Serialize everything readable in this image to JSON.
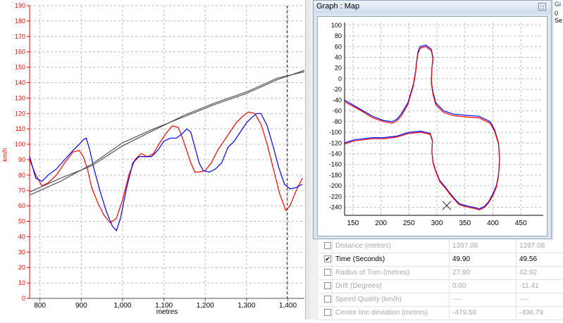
{
  "speed_chart": {
    "ylabel": "km/h",
    "xlabel": "metres",
    "y_ticks": [
      "0",
      "10",
      "20",
      "30",
      "40",
      "50",
      "60",
      "70",
      "80",
      "90",
      "100",
      "110",
      "120",
      "130",
      "140",
      "150",
      "160",
      "170",
      "180",
      "190"
    ],
    "x_ticks": [
      "800",
      "900",
      "1,000",
      "1,100",
      "1,200",
      "1,300",
      "1,400"
    ]
  },
  "map_window": {
    "title": "Graph : Map",
    "restore_label": "□",
    "y_ticks": [
      "100",
      "80",
      "60",
      "40",
      "20",
      "0",
      "-20",
      "-40",
      "-60",
      "-80",
      "-100",
      "-120",
      "-140",
      "-160",
      "-180",
      "-200",
      "-220",
      "-240"
    ],
    "x_ticks": [
      "150",
      "200",
      "250",
      "300",
      "350",
      "400",
      "450"
    ]
  },
  "side_strip": {
    "line1": "Gi",
    "line2": "0 Se"
  },
  "data_table": {
    "rows": [
      {
        "checked": false,
        "label": "Distance (metres)",
        "v1": "1397.08",
        "v2": "1397.08",
        "active": false
      },
      {
        "checked": true,
        "label": "Time (Seconds)",
        "v1": "49.90",
        "v2": "49.56",
        "active": true
      },
      {
        "checked": false,
        "label": "Radius of Turn (metres)",
        "v1": "27.90",
        "v2": "42.92",
        "active": false
      },
      {
        "checked": false,
        "label": "Drift (Degrees)",
        "v1": "0.00",
        "v2": "-11.41",
        "active": false
      },
      {
        "checked": false,
        "label": "Speed Quality (km/h)",
        "v1": "----",
        "v2": "----",
        "active": false
      },
      {
        "checked": false,
        "label": "Centre line deviation (metres)",
        "v1": "-479.58",
        "v2": "-496.79",
        "active": false
      }
    ]
  },
  "chart_data": [
    {
      "type": "line",
      "title": "",
      "xlabel": "metres",
      "ylabel": "km/h",
      "xlim": [
        775,
        1440
      ],
      "ylim": [
        0,
        190
      ],
      "grid": true,
      "cursor_x": 1398,
      "series": [
        {
          "color": "#ff0000",
          "x": [
            775,
            790,
            805,
            820,
            840,
            860,
            880,
            895,
            905,
            915,
            925,
            940,
            955,
            970,
            985,
            1000,
            1015,
            1030,
            1045,
            1060,
            1075,
            1090,
            1105,
            1120,
            1135,
            1145,
            1155,
            1165,
            1175,
            1185,
            1200,
            1215,
            1230,
            1245,
            1260,
            1275,
            1290,
            1305,
            1320,
            1335,
            1350,
            1365,
            1380,
            1395,
            1405,
            1420,
            1435
          ],
          "y": [
            90,
            80,
            73,
            75,
            80,
            88,
            95,
            96,
            92,
            84,
            72,
            62,
            54,
            49,
            52,
            64,
            80,
            90,
            94,
            92,
            94,
            101,
            107,
            112,
            111,
            104,
            96,
            88,
            82,
            82,
            83,
            88,
            96,
            102,
            108,
            114,
            118,
            121,
            120,
            113,
            100,
            84,
            68,
            57,
            60,
            70,
            78
          ]
        },
        {
          "color": "#0000ff",
          "x": [
            775,
            790,
            805,
            820,
            840,
            860,
            880,
            895,
            905,
            912,
            920,
            930,
            945,
            960,
            975,
            985,
            995,
            1010,
            1025,
            1040,
            1055,
            1070,
            1085,
            1100,
            1115,
            1130,
            1145,
            1155,
            1165,
            1175,
            1185,
            1195,
            1210,
            1225,
            1240,
            1255,
            1270,
            1285,
            1300,
            1315,
            1325,
            1335,
            1350,
            1365,
            1378,
            1392,
            1405,
            1420,
            1435
          ],
          "y": [
            92,
            78,
            76,
            80,
            84,
            90,
            96,
            100,
            103,
            104,
            97,
            85,
            70,
            57,
            47,
            44,
            52,
            72,
            88,
            92,
            92,
            92,
            96,
            102,
            104,
            104,
            107,
            110,
            108,
            98,
            88,
            83,
            82,
            84,
            88,
            98,
            102,
            108,
            114,
            118,
            120,
            120,
            112,
            98,
            85,
            74,
            71,
            72,
            74
          ]
        },
        {
          "color": "#555555",
          "x": [
            775,
            850,
            925,
            1000,
            1075,
            1150,
            1225,
            1300,
            1375,
            1440
          ],
          "y": [
            67,
            76,
            87,
            101,
            110,
            118,
            126,
            133,
            142,
            148
          ]
        },
        {
          "color": "#555555",
          "x": [
            775,
            850,
            925,
            1000,
            1075,
            1150,
            1225,
            1300,
            1375,
            1440
          ],
          "y": [
            69,
            78,
            86,
            99,
            109,
            119,
            127,
            134,
            143,
            147
          ]
        }
      ]
    },
    {
      "type": "line",
      "title": "",
      "xlabel": "",
      "ylabel": "",
      "xlim": [
        135,
        490
      ],
      "ylim": [
        -255,
        105
      ],
      "grid": true,
      "series": [
        {
          "color": "#0000ff",
          "x": [
            135,
            160,
            185,
            205,
            220,
            228,
            236,
            248,
            258,
            262,
            264,
            266,
            270,
            280,
            290,
            293,
            291,
            290,
            293,
            298,
            312,
            330,
            350,
            375,
            395,
            403,
            410,
            412,
            410,
            406,
            400,
            392,
            385,
            376,
            366,
            356,
            348,
            340,
            335,
            330,
            322,
            315,
            305,
            298,
            293,
            291,
            292,
            288,
            272,
            250,
            228,
            205,
            185,
            168,
            152,
            140,
            135
          ],
          "y": [
            -40,
            -55,
            -70,
            -78,
            -80,
            -76,
            -66,
            -45,
            -10,
            15,
            35,
            50,
            60,
            63,
            55,
            40,
            20,
            -5,
            -25,
            -45,
            -60,
            -66,
            -68,
            -70,
            -80,
            -95,
            -120,
            -150,
            -180,
            -200,
            -215,
            -230,
            -238,
            -243,
            -240,
            -238,
            -236,
            -233,
            -228,
            -222,
            -212,
            -202,
            -190,
            -172,
            -155,
            -135,
            -115,
            -102,
            -98,
            -100,
            -107,
            -110,
            -110,
            -112,
            -114,
            -118,
            -120
          ]
        },
        {
          "color": "#ff0000",
          "x": [
            135,
            160,
            185,
            205,
            220,
            228,
            236,
            248,
            258,
            262,
            264,
            266,
            270,
            280,
            290,
            293,
            291,
            290,
            293,
            298,
            312,
            330,
            350,
            375,
            395,
            403,
            410,
            412,
            410,
            406,
            400,
            392,
            385,
            376,
            366,
            356,
            348,
            340,
            335,
            330,
            322,
            315,
            305,
            298,
            293,
            291,
            292,
            288,
            272,
            250,
            228,
            205,
            185,
            168,
            152,
            140,
            135
          ],
          "y": [
            -43,
            -57,
            -73,
            -80,
            -83,
            -79,
            -70,
            -48,
            -13,
            12,
            32,
            47,
            57,
            60,
            52,
            37,
            17,
            -8,
            -29,
            -49,
            -63,
            -69,
            -71,
            -73,
            -83,
            -98,
            -122,
            -152,
            -182,
            -203,
            -218,
            -232,
            -240,
            -245,
            -242,
            -240,
            -238,
            -235,
            -230,
            -224,
            -214,
            -204,
            -192,
            -174,
            -157,
            -137,
            -117,
            -104,
            -100,
            -102,
            -109,
            -112,
            -112,
            -114,
            -116,
            -120,
            -122
          ]
        }
      ]
    }
  ]
}
